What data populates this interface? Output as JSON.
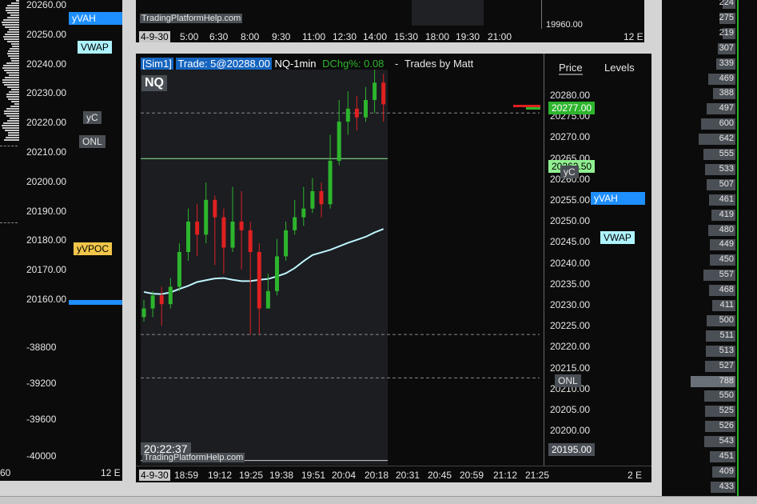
{
  "colors": {
    "background": "#0b0b0b",
    "chart_bg": "#1b1d21",
    "up_candle": "#2db52d",
    "down_candle": "#e02020",
    "vwap_line": "#bff5ff",
    "yvah_tag": "#1e8fff",
    "vwap_tag": "#aef3ff",
    "yvpoc_tag": "#f2c64a",
    "last_price": "#2db52d"
  },
  "left_panel": {
    "price_ticks": [
      "20260.00",
      "20250.00",
      "20240.00",
      "20230.00",
      "20220.00",
      "20210.00",
      "20200.00",
      "20190.00",
      "20180.00",
      "20170.00",
      "20160.00"
    ],
    "lower_ticks": [
      "-38800",
      "-39200",
      "-39600",
      "-40000"
    ],
    "tags": {
      "yvah": "yVAH",
      "vwap": "VWAP",
      "yc": "yC",
      "onl": "ONL",
      "yvpoc": "yVPOC"
    },
    "footer_left": "60",
    "footer_right": "12 E"
  },
  "top_panel": {
    "watermark": "TradingPlatformHelp.com",
    "price_tick": "19960.00",
    "time_axis": [
      "4-9-30",
      "5:00",
      "6:30",
      "8:00",
      "9:30",
      "11:00",
      "12:30",
      "14:00",
      "15:30",
      "18:00",
      "19:30",
      "21:00"
    ],
    "footer_right": "12 E"
  },
  "main_chart": {
    "header": {
      "account": "[Sim1]",
      "trade": "Trade: 5@20288.00",
      "instrument": "NQ-1min",
      "dchg": "DChg%: 0.08",
      "separator": "-",
      "author": "Trades by Matt"
    },
    "symbol": "NQ",
    "clock": "20:22:37",
    "watermark": "TradingPlatformHelp.com",
    "price_header": "Price",
    "levels_header": "Levels",
    "price_ticks": [
      "20280.00",
      "20275.00",
      "20270.00",
      "20265.00",
      "20260.00",
      "20255.00",
      "20250.00",
      "20245.00",
      "20240.00",
      "20235.00",
      "20230.00",
      "20225.00",
      "20220.00",
      "20215.00",
      "20210.00",
      "20205.00",
      "20200.00"
    ],
    "last_price": "20277.00",
    "bottom_price": "20195.00",
    "tags": {
      "green_level": "20262.50",
      "yc": "yC",
      "onl": "ONL",
      "yvah": "yVAH",
      "vwap": "VWAP"
    },
    "time_axis": [
      "4-9-30",
      "18:59",
      "19:12",
      "19:25",
      "19:38",
      "19:51",
      "20:04",
      "20:18",
      "20:31",
      "20:45",
      "20:59",
      "21:12",
      "21:25"
    ],
    "footer_right": "2 E"
  },
  "chart_data": {
    "type": "candlestick",
    "title": "NQ-1min",
    "ylim": [
      20192,
      20283
    ],
    "vwap": [
      20231.8,
      20231.4,
      20231.3,
      20231.7,
      20232.5,
      20233.2,
      20234.1,
      20234.5,
      20234.9,
      20235.0,
      20234.6,
      20234.3,
      20234.3,
      20234.6,
      20234.8,
      20235.4,
      20236.1,
      20237.3,
      20238.9,
      20240.3,
      20240.9,
      20241.5,
      20242.3,
      20243.1,
      20243.8,
      20244.5,
      20245.5,
      20246.3
    ],
    "candles": [
      [
        20226,
        20228,
        20230,
        20225
      ],
      [
        20228,
        20231,
        20232,
        20226
      ],
      [
        20231,
        20229,
        20233,
        20224
      ],
      [
        20229,
        20233,
        20235,
        20228
      ],
      [
        20233,
        20241,
        20243,
        20232
      ],
      [
        20241,
        20248,
        20251,
        20239
      ],
      [
        20248,
        20245,
        20252,
        20240
      ],
      [
        20245,
        20253,
        20257,
        20243
      ],
      [
        20253,
        20249,
        20254,
        20238
      ],
      [
        20249,
        20242,
        20251,
        20236
      ],
      [
        20242,
        20248,
        20256,
        20241
      ],
      [
        20248,
        20246,
        20255,
        20237
      ],
      [
        20246,
        20241,
        20248,
        20222
      ],
      [
        20241,
        20228,
        20243,
        20222
      ],
      [
        20228,
        20232,
        20236,
        20228
      ],
      [
        20232,
        20240,
        20244,
        20231
      ],
      [
        20240,
        20246,
        20248,
        20239
      ],
      [
        20246,
        20249,
        20253,
        20245
      ],
      [
        20249,
        20251,
        20256,
        20247
      ],
      [
        20251,
        20255,
        20258,
        20250
      ],
      [
        20255,
        20252,
        20257,
        20249
      ],
      [
        20252,
        20262,
        20268,
        20251
      ],
      [
        20262,
        20271,
        20276,
        20261
      ],
      [
        20271,
        20274,
        20278,
        20268
      ],
      [
        20274,
        20272,
        20277,
        20269
      ],
      [
        20272,
        20276,
        20279,
        20271
      ],
      [
        20276,
        20280,
        20283,
        20273
      ],
      [
        20280,
        20275,
        20282,
        20271
      ]
    ]
  },
  "right_panel": {
    "volumes": [
      "224",
      "275",
      "219",
      "307",
      "339",
      "469",
      "388",
      "497",
      "600",
      "642",
      "555",
      "533",
      "507",
      "461",
      "419",
      "480",
      "449",
      "450",
      "557",
      "468",
      "411",
      "500",
      "511",
      "513",
      "527",
      "788",
      "550",
      "525",
      "526",
      "543",
      "451",
      "409",
      "433"
    ]
  }
}
